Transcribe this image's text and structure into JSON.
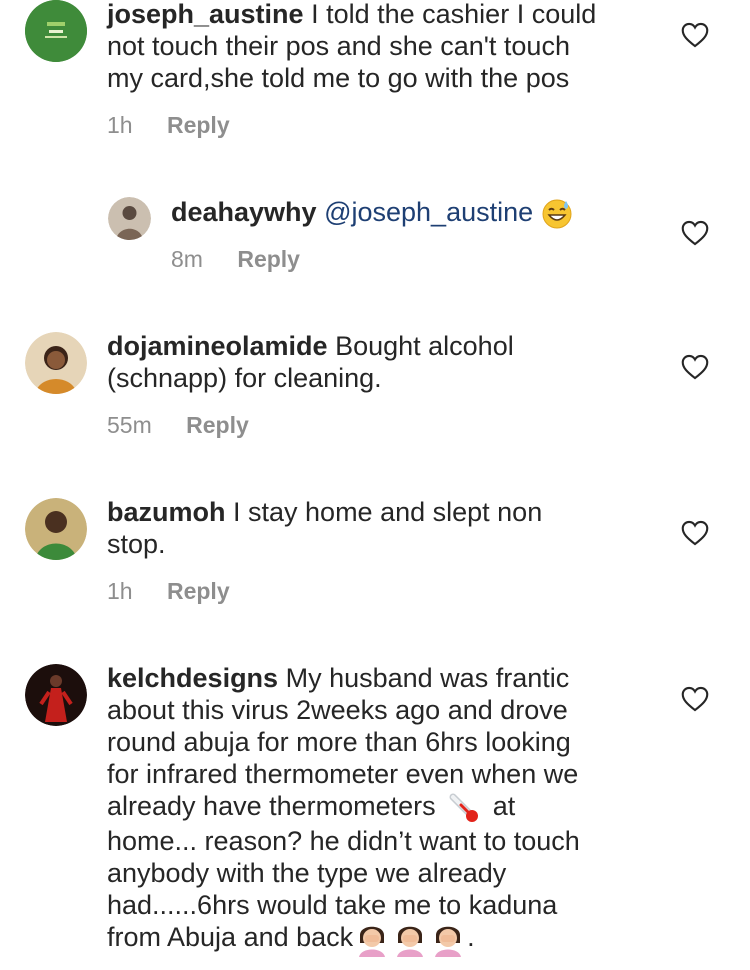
{
  "comments": [
    {
      "username": "joseph_austine",
      "lines": [
        "I told the cashier I could",
        "not touch their pos and she can't touch",
        "my card,she told me to go with the pos"
      ],
      "time": "1h",
      "reply_label": "Reply",
      "avatar_icon": "green-logo-avatar-icon",
      "avatar_color": "#3d8a3c"
    },
    {
      "username": "deahaywhy",
      "mention": "@joseph_austine",
      "emoji": "sweat-smile-emoji-icon",
      "time": "8m",
      "reply_label": "Reply",
      "avatar_icon": "profile-photo-avatar-icon",
      "avatar_color": "#b9a99a"
    },
    {
      "username": "dojamineolamide",
      "lines": [
        "Bought alcohol",
        "(schnapp) for cleaning."
      ],
      "time": "55m",
      "reply_label": "Reply",
      "avatar_icon": "profile-photo-avatar-icon",
      "avatar_color": "#d9b98e"
    },
    {
      "username": "bazumoh",
      "lines": [
        "I stay home and slept non",
        "stop."
      ],
      "time": "1h",
      "reply_label": "Reply",
      "avatar_icon": "profile-photo-avatar-icon",
      "avatar_color": "#6d7a4f"
    },
    {
      "username": "kelchdesigns",
      "lines": [
        "My husband was frantic",
        "about this virus 2weeks ago and drove",
        "round abuja for more than 6hrs looking",
        "for infrared thermometer even when we",
        "already have thermometers",
        "at",
        "home... reason? he didn’t want to touch",
        "anybody with the type we already",
        "had......6hrs would take me to kaduna",
        "from Abuja and back",
        "."
      ],
      "avatar_icon": "profile-photo-avatar-icon",
      "avatar_color": "#2a1a16"
    }
  ],
  "icons": {
    "like": "heart-outline-icon",
    "thermometer": "thermometer-emoji-icon",
    "facepalm": "woman-facepalming-emoji-icon"
  },
  "colors": {
    "text": "#262626",
    "meta": "#8e8e8e",
    "mention": "#1e3f73"
  }
}
